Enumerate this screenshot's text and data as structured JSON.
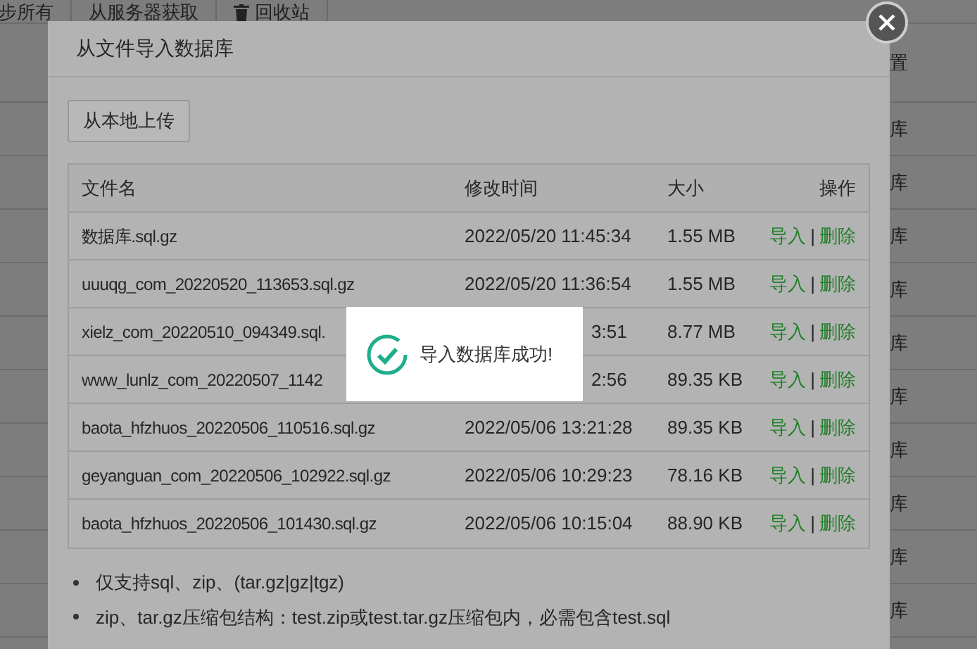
{
  "background_toolbar": {
    "buttons": [
      {
        "label": "步所有",
        "kind": "plain"
      },
      {
        "label": "从服务器获取",
        "kind": "plain"
      },
      {
        "label": "回收站",
        "kind": "trash"
      }
    ]
  },
  "background_table": {
    "column_header": "置",
    "cells": [
      "库",
      "库",
      "库",
      "库",
      "库",
      "库",
      "库",
      "库",
      "库",
      "库"
    ]
  },
  "dialog": {
    "title": "从文件导入数据库",
    "upload_button": "从本地上传",
    "columns": [
      "文件名",
      "修改时间",
      "大小",
      "操作"
    ],
    "action_separator": "|",
    "rows": [
      {
        "name": "数据库.sql.gz",
        "modified": "2022/05/20 11:45:34",
        "size": "1.55 MB",
        "actions": [
          "导入",
          "删除"
        ]
      },
      {
        "name": "uuuqg_com_20220520_113653.sql.gz",
        "modified": "2022/05/20 11:36:54",
        "size": "1.55 MB",
        "actions": [
          "导入",
          "删除"
        ]
      },
      {
        "name": "xielz_com_20220510_094349.sql.",
        "modified": "3:51",
        "size": "8.77 MB",
        "actions": [
          "导入",
          "删除"
        ]
      },
      {
        "name": "www_lunlz_com_20220507_1142",
        "modified": "2:56",
        "size": "89.35 KB",
        "actions": [
          "导入",
          "删除"
        ]
      },
      {
        "name": "baota_hfzhuos_20220506_110516.sql.gz",
        "modified": "2022/05/06 13:21:28",
        "size": "89.35 KB",
        "actions": [
          "导入",
          "删除"
        ]
      },
      {
        "name": "geyanguan_com_20220506_102922.sql.gz",
        "modified": "2022/05/06 10:29:23",
        "size": "78.16 KB",
        "actions": [
          "导入",
          "删除"
        ]
      },
      {
        "name": "baota_hfzhuos_20220506_101430.sql.gz",
        "modified": "2022/05/06 10:15:04",
        "size": "88.90 KB",
        "actions": [
          "导入",
          "删除"
        ]
      }
    ],
    "notes": [
      "仅支持sql、zip、(tar.gz|gz|tgz)",
      "zip、tar.gz压缩包结构：test.zip或test.tar.gz压缩包内，必需包含test.sql"
    ]
  },
  "toast": {
    "message": "导入数据库成功!"
  }
}
